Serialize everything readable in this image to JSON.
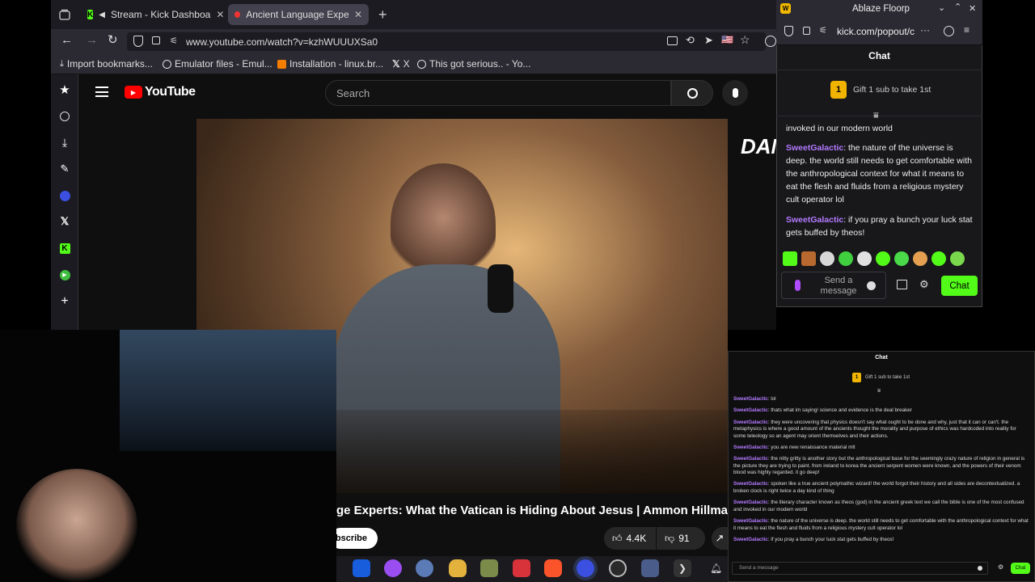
{
  "browser": {
    "tabs": [
      {
        "label": "Stream - Kick Dashboa"
      },
      {
        "label": "Ancient Language Experts"
      }
    ],
    "url": "www.youtube.com/watch?v=kzhWUUUXSa0",
    "bookmarks": [
      {
        "label": "Import bookmarks..."
      },
      {
        "label": "Emulator files - Emul..."
      },
      {
        "label": "Installation - linux.br..."
      },
      {
        "label": "X"
      },
      {
        "label": "This got serious.. - Yo..."
      }
    ],
    "flag": "🇺🇸"
  },
  "youtube": {
    "logo_text": "YouTube",
    "search_placeholder": "Search",
    "video_overlay_text": "DAN",
    "title": "ge Experts: What the Vatican is Hiding About Jesus | Ammon Hillman",
    "subscribe": "bscribe",
    "likes": "4.4K",
    "dislikes": "91"
  },
  "kick_popout": {
    "window_title": "Ablaze Floorp",
    "url": "kick.com/popout/c",
    "header": "Chat",
    "gift_rank": "1",
    "gift_text": "Gift 1 sub to take 1st",
    "messages": [
      {
        "user": "",
        "text": "invoked in our modern world"
      },
      {
        "user": "SweetGalactic",
        "text": "the nature of the universe is deep. the world still needs to get comfortable with the anthropological context for what it means to eat the flesh and fluids from a religious mystery cult operator lol"
      },
      {
        "user": "SweetGalactic",
        "text": "if you pray a bunch your luck stat gets buffed by theos!"
      }
    ],
    "input_placeholder": "Send a message",
    "send_label": "Chat"
  },
  "chat_overlay": {
    "header": "Chat",
    "gift_rank": "1",
    "gift_text": "Gift 1 sub to take 1st",
    "messages": [
      {
        "user": "SweetGalactic",
        "text": "lol"
      },
      {
        "user": "SweetGalactic",
        "text": "thats what im saying! science and evidence is the deal breaker"
      },
      {
        "user": "SweetGalactic",
        "text": "they were uncovering that physics doesn't say what ought to be done and why, just that it can or can't. the metaphysics is where a good amount of the ancients thought the morality and purpose of ethics was hardcoded into reality for some teleology so an agent may orient themselves and their actions."
      },
      {
        "user": "SweetGalactic",
        "text": "you are new renaissance material mlt"
      },
      {
        "user": "SweetGalactic",
        "text": "the nitty gritty is another story but the anthropological base for the seemingly crazy nature of religion in general is the picture they are trying to paint. from ireland to korea the ancient serpent women were known, and the powers of their venom blood was highly regarded. it go deep!"
      },
      {
        "user": "SweetGalactic",
        "text": "spoken like a true ancient polymathic wizard! the world forgot their history and all sides are decontextualized. a broken clock is right twice a day kind of thing"
      },
      {
        "user": "SweetGalactic",
        "text": "the literary character known as theos (god) in the ancient greek text we call the bible is one of the most confused and invoked in our modern world"
      },
      {
        "user": "SweetGalactic",
        "text": "the nature of the universe is deep. the world still needs to get comfortable with the anthropological context for what it means to eat the flesh and fluids from a religious mystery cult operator lol"
      },
      {
        "user": "SweetGalactic",
        "text": "if you pray a bunch your luck stat gets buffed by theos!"
      }
    ],
    "input_placeholder": "Send a message",
    "send_label": "Chat"
  },
  "colors": {
    "kick_green": "#53fc18",
    "username_purple": "#b47bff",
    "youtube_red": "#ff0000"
  }
}
